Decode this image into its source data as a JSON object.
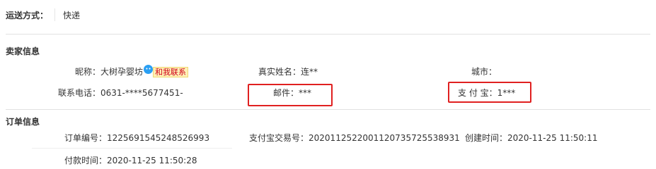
{
  "shipping": {
    "label": "运送方式：",
    "value": "快递"
  },
  "seller": {
    "section_title": "卖家信息",
    "nickname_label": "昵称：",
    "nickname_value": "大树孕婴坊",
    "contact_button": "和我联系",
    "realname_label": "真实姓名：",
    "realname_value": "连**",
    "city_label": "城市：",
    "city_value": "",
    "phone_label": "联系电话：",
    "phone_value": "0631-****5677451-",
    "email_label": "邮件：",
    "email_value": "***",
    "alipay_label": "支 付 宝：",
    "alipay_value": "1***"
  },
  "order": {
    "section_title": "订单信息",
    "order_no_label": "订单编号：",
    "order_no_value": "1225691545248526993",
    "trade_no_label": "支付宝交易号：",
    "trade_no_value": "2020112522001120735725538931",
    "created_label": "创建时间：",
    "created_value": "2020-11-25 11:50:11",
    "paid_label": "付款时间：",
    "paid_value": "2020-11-25 11:50:28"
  },
  "colors": {
    "highlight_box": "#e02020",
    "wangwang_icon": "#2a9ff3",
    "contact_badge_bg": "#fef1b6",
    "contact_badge_text": "#d0001b"
  },
  "icons": {
    "wangwang": "chat-bubble-icon"
  }
}
